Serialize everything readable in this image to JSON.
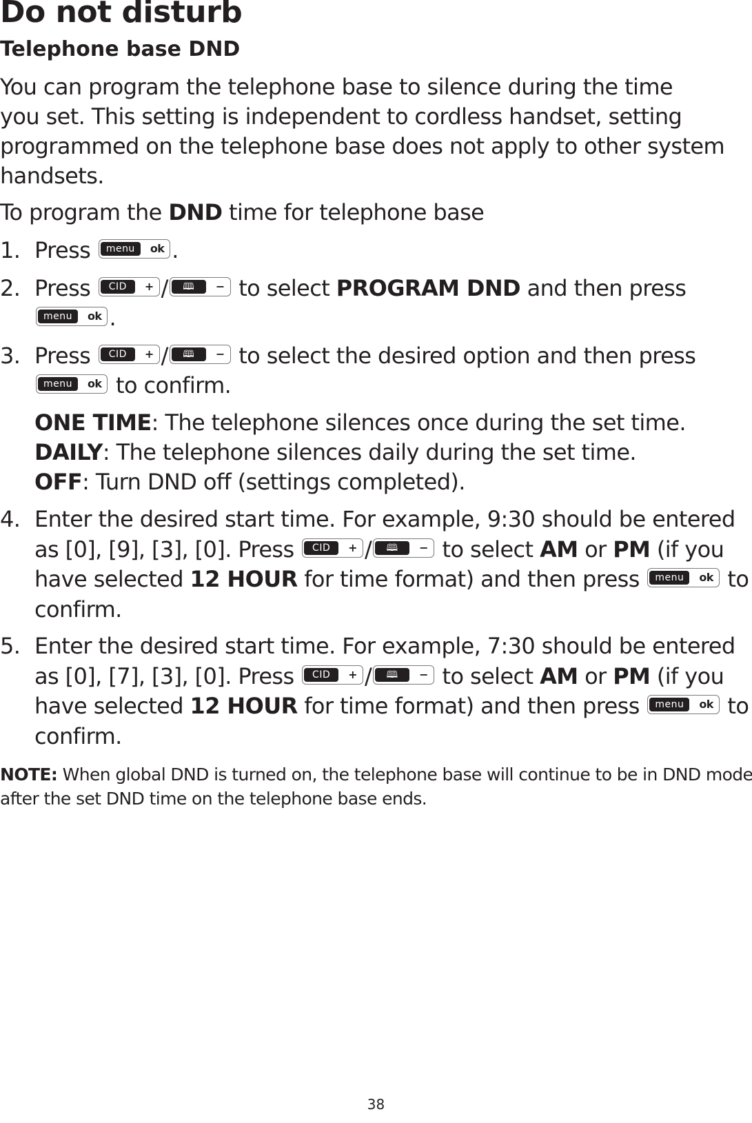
{
  "title": "Do not disturb",
  "subtitle": "Telephone base DND",
  "intro": [
    "You can program the telephone base to silence during the time",
    "you set. This setting is independent to cordless handset, setting",
    "programmed on the telephone base does not apply to other system",
    "handsets."
  ],
  "program_line": {
    "pre": "To program the ",
    "bold": "DND",
    "post": " time for telephone base"
  },
  "keys": {
    "menu": {
      "dark": "menu",
      "light": "ok",
      "name": "menu-ok-key"
    },
    "cid": {
      "dark": "CID",
      "light": "+",
      "name": "cid-plus-key"
    },
    "book": {
      "icon": "book-icon",
      "light": "−",
      "name": "phonebook-minus-key"
    },
    "slash": "/"
  },
  "steps": [
    {
      "num": "1.",
      "press": "Press",
      "end": "."
    },
    {
      "num": "2.",
      "press": "Press",
      "mid": " to select ",
      "bold": "PROGRAM DND",
      "post": " and then press",
      "end": "."
    },
    {
      "num": "3.",
      "press": "Press",
      "mid": " to select the desired option and then press",
      "end": " to confirm."
    },
    {
      "num": "4.",
      "l1": "Enter the desired start time. For example, 9:30 should be entered",
      "l2pre": "as [0], [9], [3], [0]. Press ",
      "l2mid": " to select ",
      "am": "AM",
      "or": " or ",
      "pm": "PM",
      "l2post": " (if you",
      "l3pre": "have selected ",
      "l3bold": "12 HOUR",
      "l3post": " for time format) and then press ",
      "l3end": " to",
      "l4": "confirm."
    },
    {
      "num": "5.",
      "l1": "Enter the desired start time. For example, 7:30 should be entered",
      "l2pre": "as [0], [7], [3], [0]. Press ",
      "l2mid": " to select ",
      "am": "AM",
      "or": " or ",
      "pm": "PM",
      "l2post": " (if you",
      "l3pre": "have selected ",
      "l3bold": "12 HOUR",
      "l3post": " for time format) and then press ",
      "l3end": " to",
      "l4": "confirm."
    }
  ],
  "options": [
    {
      "label": "ONE TIME",
      "text": ": The telephone silences once during the set time."
    },
    {
      "label": "DAILY",
      "text": ": The telephone silences daily during the set time."
    },
    {
      "label": "OFF",
      "text": ": Turn DND off (settings completed)."
    }
  ],
  "note": {
    "label": "NOTE:",
    "line1": " When global DND is turned on, the telephone base will continue to be in DND mode",
    "line2": "after the set DND time on the telephone base ends."
  },
  "page_number": "38"
}
